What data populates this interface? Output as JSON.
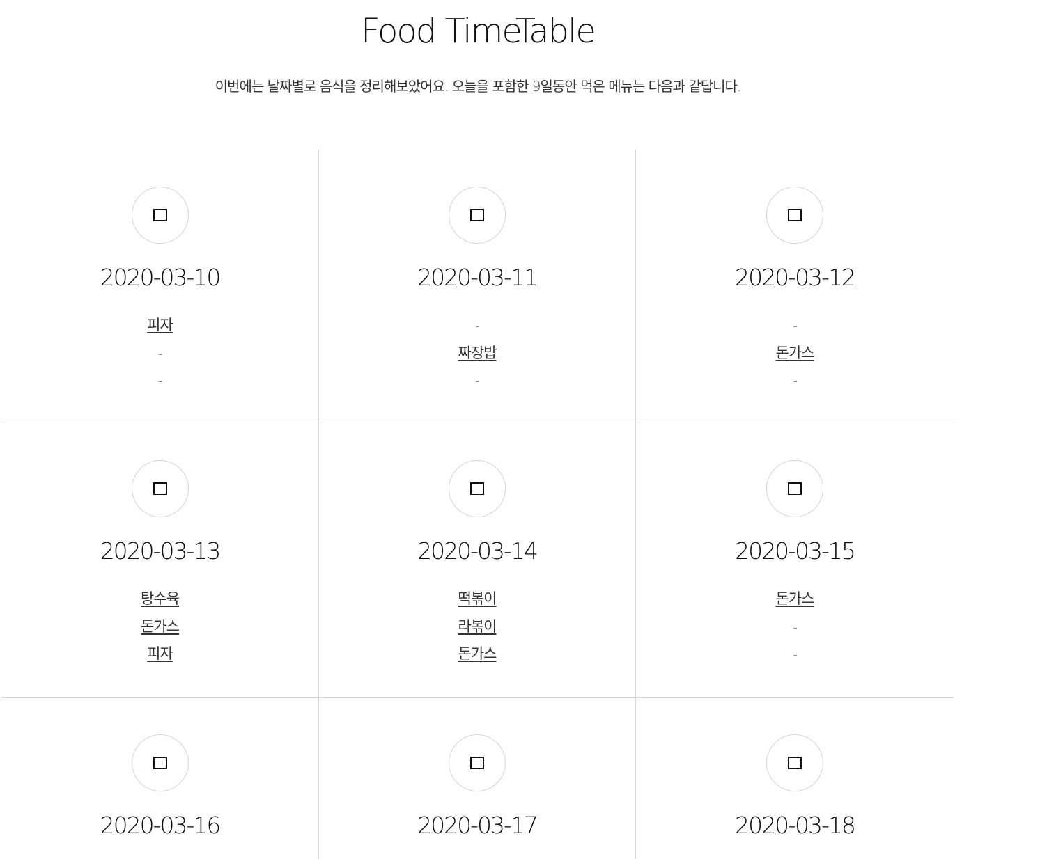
{
  "page": {
    "title": "Food TimeTable",
    "subtitle": "이번에는 날짜별로 음식을 정리해보았어요. 오늘을 포함한 9일동안 먹은 메뉴는 다음과 같답니다."
  },
  "days": [
    {
      "date": "2020-03-10",
      "meals": [
        "피자",
        "-",
        "-"
      ]
    },
    {
      "date": "2020-03-11",
      "meals": [
        "-",
        "짜장밥",
        "-"
      ]
    },
    {
      "date": "2020-03-12",
      "meals": [
        "-",
        "돈가스",
        "-"
      ]
    },
    {
      "date": "2020-03-13",
      "meals": [
        "탕수육",
        "돈가스",
        "피자"
      ]
    },
    {
      "date": "2020-03-14",
      "meals": [
        "떡볶이",
        "라볶이",
        "돈가스"
      ]
    },
    {
      "date": "2020-03-15",
      "meals": [
        "돈가스",
        "-",
        "-"
      ]
    },
    {
      "date": "2020-03-16",
      "meals": []
    },
    {
      "date": "2020-03-17",
      "meals": []
    },
    {
      "date": "2020-03-18",
      "meals": []
    }
  ],
  "icons": {
    "day_icon": "square-icon",
    "text_color": "#111111",
    "divider_color": "#d6d6d6"
  }
}
